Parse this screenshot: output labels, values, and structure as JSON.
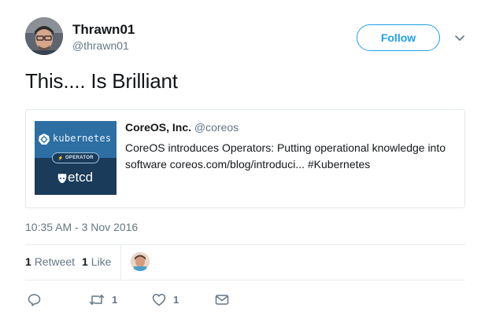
{
  "author": {
    "name": "Thrawn01",
    "handle": "@thrawn01",
    "avatar_icon": "user-avatar"
  },
  "follow_label": "Follow",
  "tweet_text": "This.... Is Brilliant",
  "quoted": {
    "name": "CoreOS, Inc.",
    "handle": "@coreos",
    "text": "CoreOS introduces Operators: Putting operational knowledge into software coreos.com/blog/introduci... #Kubernetes",
    "thumb": {
      "kubernetes": "kubernetes",
      "operator": "OPERATOR",
      "etcd": "etcd"
    }
  },
  "timestamp": "10:35 AM - 3 Nov 2016",
  "stats": {
    "retweets_count": "1",
    "retweets_label": "Retweet",
    "likes_count": "1",
    "likes_label": "Like"
  },
  "actions": {
    "reply_count": "",
    "retweet_count": "1",
    "like_count": "1"
  },
  "colors": {
    "accent": "#1da1f2",
    "muted": "#657786",
    "text": "#14171a",
    "border": "#e1e8ed"
  }
}
